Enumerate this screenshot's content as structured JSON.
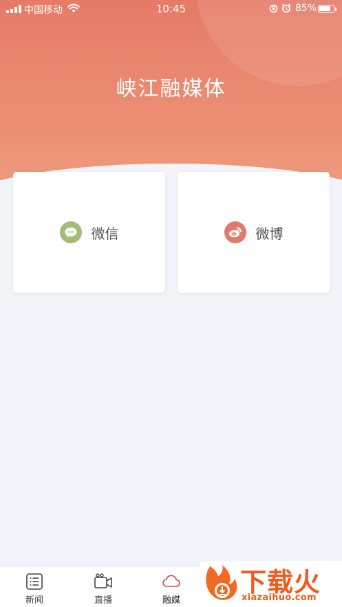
{
  "status_bar": {
    "carrier": "中国移动",
    "time": "10:45",
    "battery_percent": "85%",
    "battery_level": 0.85
  },
  "header": {
    "title": "峡江融媒体"
  },
  "cards": [
    {
      "label": "微信",
      "icon": "wechat-icon",
      "color": "#a6bb7a"
    },
    {
      "label": "微博",
      "icon": "weibo-icon",
      "color": "#e07a6d"
    }
  ],
  "tabbar": {
    "items": [
      {
        "label": "新闻",
        "icon": "news-list-icon"
      },
      {
        "label": "直播",
        "icon": "video-camera-icon"
      },
      {
        "label": "融媒",
        "icon": "cloud-icon",
        "active": true
      }
    ],
    "active_color": "#d9473b"
  },
  "watermark": {
    "title": "下载火",
    "url": "xiazaihuo.com"
  },
  "colors": {
    "header_gradient_top": "#e57b67",
    "header_gradient_bottom": "#ee9a7c",
    "background": "#f1f4f8"
  }
}
